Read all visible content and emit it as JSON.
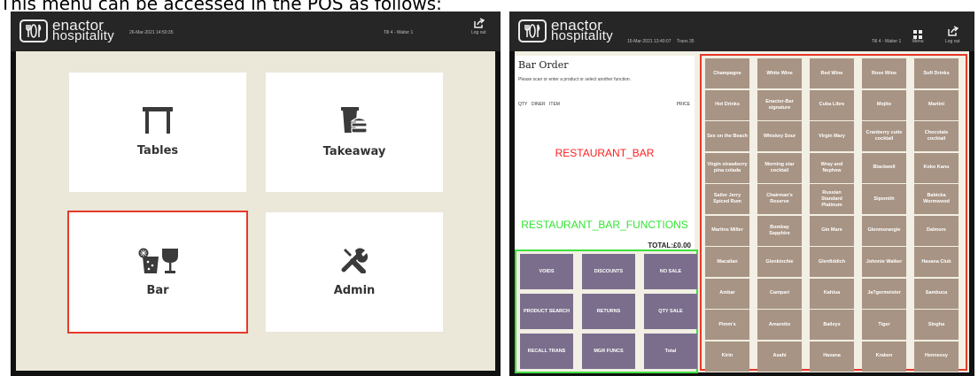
{
  "caption": "This menu can be accessed in the POS as follows:",
  "brand": {
    "line1": "enactor",
    "line2": "hospitality"
  },
  "left_screen": {
    "datetime": "26-Mar-2021 14:50:35",
    "till": "Till 4 - Waiter 1",
    "logout": "Log out",
    "tiles": [
      {
        "label": "Tables",
        "icon": "table-icon"
      },
      {
        "label": "Takeaway",
        "icon": "takeaway-icon"
      },
      {
        "label": "Bar",
        "icon": "cocktail-glass-icon"
      },
      {
        "label": "Admin",
        "icon": "tools-icon"
      }
    ]
  },
  "right_screen": {
    "datetime": "15-Mar-2021 13:40:07",
    "trans": "Trans 35",
    "till": "Till 4 - Waiter 1",
    "menu": "Menu",
    "logout": "Log out",
    "order": {
      "title": "Bar Order",
      "hint": "Please scan or enter a product or select another function.",
      "col_qty": "QTY",
      "col_diner": "DINER",
      "col_item": "ITEM",
      "col_price": "PRICE",
      "menu_label": "RESTAURANT_BAR",
      "functions_label": "RESTAURANT_BAR_FUNCTIONS",
      "total": "TOTAL:£0.00"
    },
    "functions": [
      "VOIDS",
      "DISCOUNTS",
      "NO SALE",
      "PRODUCT SEARCH",
      "RETURNS",
      "QTY SALE",
      "RECALL TRANS",
      "MGR FUNCS",
      "Total"
    ],
    "products": [
      "Champagne",
      "White Wine",
      "Red Wine",
      "Rose Wine",
      "Soft Drinks",
      "Hot Drinks",
      "Enactor-Bar signature",
      "Cuba Libre",
      "Mojito",
      "Martini",
      "Sex on the Beach",
      "Whiskey Sour",
      "Virgin Mary",
      "Cranberry cutie cocktail",
      "Chocolate cocktail",
      "Virgin strawberry pina colada",
      "Morning star cocktail",
      "Wray and Nephew",
      "Blackwell",
      "Koko Kanu",
      "Sailor Jerry Spiced Rum",
      "Chairman's Reserve",
      "Russian Standard Platinum",
      "Sipsmith",
      "Babicka Wormwood",
      "Martins Miller",
      "Bombay Sapphire",
      "Gin Mare",
      "Glenmorangie",
      "Dalmore",
      "Macallan",
      "Glenkinchie",
      "Glenfiddich",
      "Johnnie Walker",
      "Havana Club",
      "Ambar",
      "Campari",
      "Kahlua",
      "Ja?germeister",
      "Sambuca",
      "Pimm's",
      "Amaretto",
      "Baileys",
      "Tiger",
      "Singha",
      "Kirin",
      "Asahi",
      "Havana",
      "Kraken",
      "Hennessy"
    ]
  },
  "colors": {
    "topbar": "#262626",
    "left_bg": "#ebe7d9",
    "func_button": "#7a6e8c",
    "product_button": "#a89484",
    "highlight_red": "#e53a2c",
    "highlight_green": "#3fe03f",
    "label_red": "#ff2020",
    "label_green": "#33e433"
  }
}
